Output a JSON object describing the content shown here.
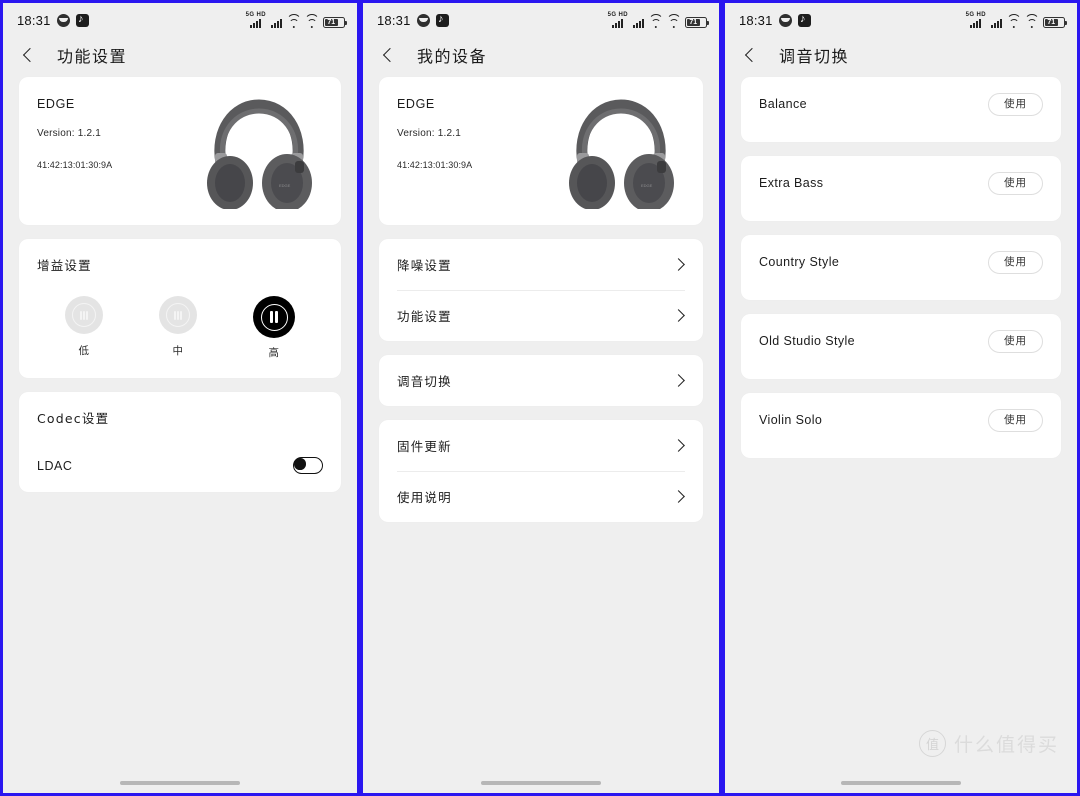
{
  "status_bar": {
    "time": "18:31",
    "icons": [
      "smiley-icon",
      "tiktok-icon"
    ],
    "network_label": "5G HD",
    "battery_level": "71"
  },
  "screen1": {
    "title": "功能设置",
    "device": {
      "name": "EDGE",
      "version": "Version: 1.2.1",
      "mac": "41:42:13:01:30:9A"
    },
    "gain": {
      "title": "增益设置",
      "options": [
        {
          "label": "低",
          "selected": false
        },
        {
          "label": "中",
          "selected": false
        },
        {
          "label": "高",
          "selected": true
        }
      ]
    },
    "codec": {
      "title": "Codec设置",
      "row_label": "LDAC",
      "enabled": false
    }
  },
  "screen2": {
    "title": "我的设备",
    "device": {
      "name": "EDGE",
      "version": "Version: 1.2.1",
      "mac": "41:42:13:01:30:9A"
    },
    "groups": [
      {
        "rows": [
          {
            "label": "降噪设置"
          },
          {
            "label": "功能设置"
          }
        ]
      },
      {
        "rows": [
          {
            "label": "调音切换"
          }
        ]
      },
      {
        "rows": [
          {
            "label": "固件更新"
          },
          {
            "label": "使用说明"
          }
        ]
      }
    ]
  },
  "screen3": {
    "title": "调音切换",
    "button_label": "使用",
    "presets": [
      {
        "label": "Balance"
      },
      {
        "label": "Extra Bass"
      },
      {
        "label": "Country Style"
      },
      {
        "label": "Old Studio Style"
      },
      {
        "label": "Violin Solo"
      }
    ]
  },
  "watermark": {
    "logo": "值",
    "text": "什么值得买"
  },
  "colors": {
    "background": "#efefef",
    "card": "#ffffff",
    "accent_selected": "#000000",
    "divider_border": "#2a16f0"
  }
}
